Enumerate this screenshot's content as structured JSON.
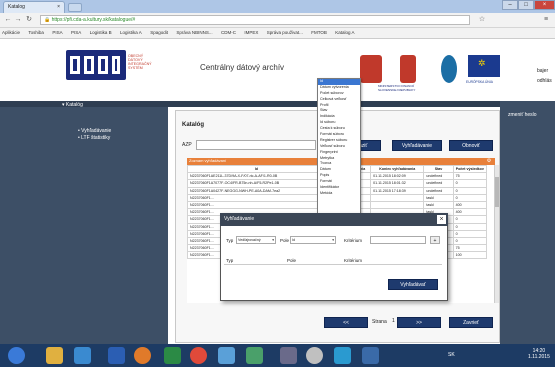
{
  "browser": {
    "tab_title": "Katalog",
    "url": "https://pfi.cda-a.kultury.sk/katalogue/#",
    "bookmarks": [
      "Aplikácie",
      "Toshiba",
      "PISA",
      "PISA",
      "Logistika B",
      "Logistika A",
      "Spagodit",
      "Správa NBINNS...",
      "CDM-C",
      "IMPEX",
      "Správa použivat...",
      "FMTOB",
      "Katalog A"
    ]
  },
  "header": {
    "logo_text": "ODIS",
    "logo_subtext": [
      "OBECNÝ",
      "DÁTOVÝ",
      "INTEGRAČNÝ",
      "SYSTÉM"
    ],
    "app_title": "Centrálny dátový archív",
    "ministry": "MINISTERSTVO FINANCIÍ SLOVENSKEJ REPUBLIKY",
    "eu_label": "EURÓPSKA ÚNIA",
    "right_cut": [
      "bajer",
      "odhlás"
    ]
  },
  "sidebar": {
    "section": "Katalóg",
    "items": [
      "Vyhľadávanie",
      "LTF štatistiky"
    ]
  },
  "right_panel": {
    "text": "zmeniť heslo"
  },
  "main": {
    "heading": "Katalóg",
    "search_label": "AZP",
    "btn_zobrazit": "Zobraziť",
    "btn_vyhladavanie": "Vyhľadávanie",
    "btn_obnovit": "Obnoviť",
    "grid_caption": "Zoznam vyhľadávaní",
    "columns": [
      "Id",
      "Záčiatok vyhľadania",
      "Koniec vyhľadávania",
      "Stav",
      "Počet výsledkov"
    ],
    "rows": [
      [
        "N2237060F1AE211L-37D/9A-X-F/07-ric-A-AF/1-R0-0B",
        "01.11.2015 18:01:35",
        "01.11.2015 18:02:09",
        "undefined",
        "75"
      ],
      [
        "N2237060F1A7077F-OC4/FR-B75n-nh-A/F5-R2Pe1-0B",
        "01.11.2015 18:01:32",
        "01.11.2015 18:01:32",
        "undefined",
        "0"
      ],
      [
        "N2237060F1A0427F-NEGGG-NWH-PE-A0A-DAM-7ea2",
        "01.11.2015 17:18:39",
        "01.11.2015 17:18:39",
        "undefined",
        "0"
      ],
      [
        "N2237060F1…",
        "",
        "",
        "taskl",
        "0"
      ],
      [
        "N2237060F1…",
        "",
        "",
        "taskl",
        "400"
      ],
      [
        "N2237060F1…",
        "",
        "",
        "taskl",
        "400"
      ],
      [
        "N2237060F1…",
        "",
        "",
        "taskl",
        "0"
      ],
      [
        "N2237060F1…",
        "",
        "",
        "taskl",
        "0"
      ],
      [
        "N2237060F1…",
        "",
        "",
        "taskl",
        "0"
      ],
      [
        "N2237060F1…",
        "",
        "",
        "taskl",
        "0"
      ],
      [
        "N2237060F1…",
        "",
        "",
        "taskl",
        "75"
      ],
      [
        "N2237060F1…",
        "",
        "",
        "taskl",
        "100"
      ]
    ],
    "pager_prev": "<<",
    "pager_label": "Strana",
    "pager_value": "1",
    "pager_next": ">>",
    "btn_zavriet": "Zavrieť"
  },
  "dropdown": {
    "options": [
      "Id",
      "Dátum vytvorenia",
      "Počet súborov",
      "Celková veľkosť",
      "Profil",
      "Stav",
      "Indikácia",
      "Id súboru",
      "Cesta k súboru",
      "Formát súboru",
      "Registrer súboru",
      "Veľkosť súboru",
      "Fingerprint",
      "Metrytka",
      "Tvorca",
      "Dátum",
      "Popis",
      "Formát",
      "Identifikátor",
      "Metóda"
    ],
    "selected_index": 0
  },
  "modal": {
    "title": "Vyhľadávanie",
    "typ_label": "Typ",
    "typ_value": "Vedľajrovačný",
    "pole_label": "Pole",
    "pole_value": "Id",
    "kriterium_label": "Kritérium",
    "col_typ": "Typ",
    "col_pole": "Pole",
    "col_kriterium": "Kritérium",
    "btn_search": "Vyhľadávať"
  },
  "taskbar": {
    "time": "14:20",
    "date": "1.11.2015",
    "lang": "SK"
  },
  "colors": {
    "sidebar": "#3d4f66",
    "button": "#1e3a6e",
    "grid_header": "#e8803a",
    "dropdown_highlight": "#3a76d1",
    "taskbar": "#1d3b64"
  }
}
